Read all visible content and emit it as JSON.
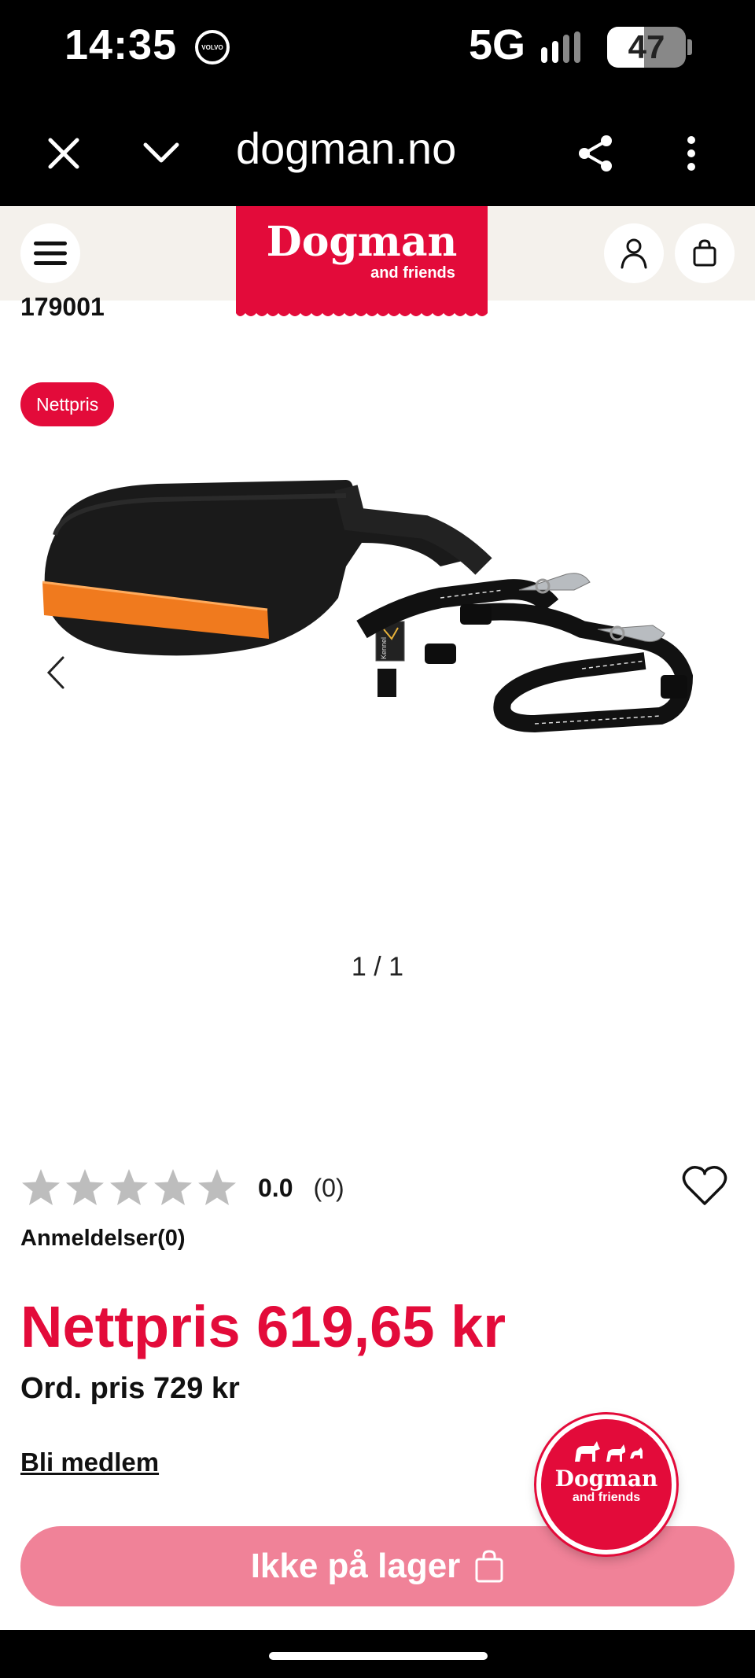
{
  "status_bar": {
    "time": "14:35",
    "network": "5G",
    "battery": "47",
    "battery_level": 0.47,
    "volvo_icon": "volvo-logo-icon"
  },
  "browser": {
    "url": "dogman.no",
    "close_icon": "close-icon",
    "chevron_icon": "chevron-down-icon",
    "share_icon": "share-icon",
    "more_icon": "more-vert-icon"
  },
  "header": {
    "logo_main": "Dogman",
    "logo_sub": "and friends",
    "brand_color": "#e30b3a",
    "bg_color": "#f4f1ec"
  },
  "product": {
    "sku": "179001",
    "badge": "Nettpris",
    "pager": "1 / 1",
    "rating_value": "0.0",
    "rating_count": "(0)",
    "stars_filled": 0,
    "reviews_link": "Anmeldelser(0)",
    "price": "Nettpris 619,65 kr",
    "ord_price": "Ord. pris 729 kr",
    "member_link": "Bli medlem",
    "cta_label": "Ikke på lager",
    "cta_color": "#f08298",
    "image_brand_text": "Kennel"
  },
  "float_badge": {
    "line1": "Dogman",
    "line2": "and friends"
  }
}
